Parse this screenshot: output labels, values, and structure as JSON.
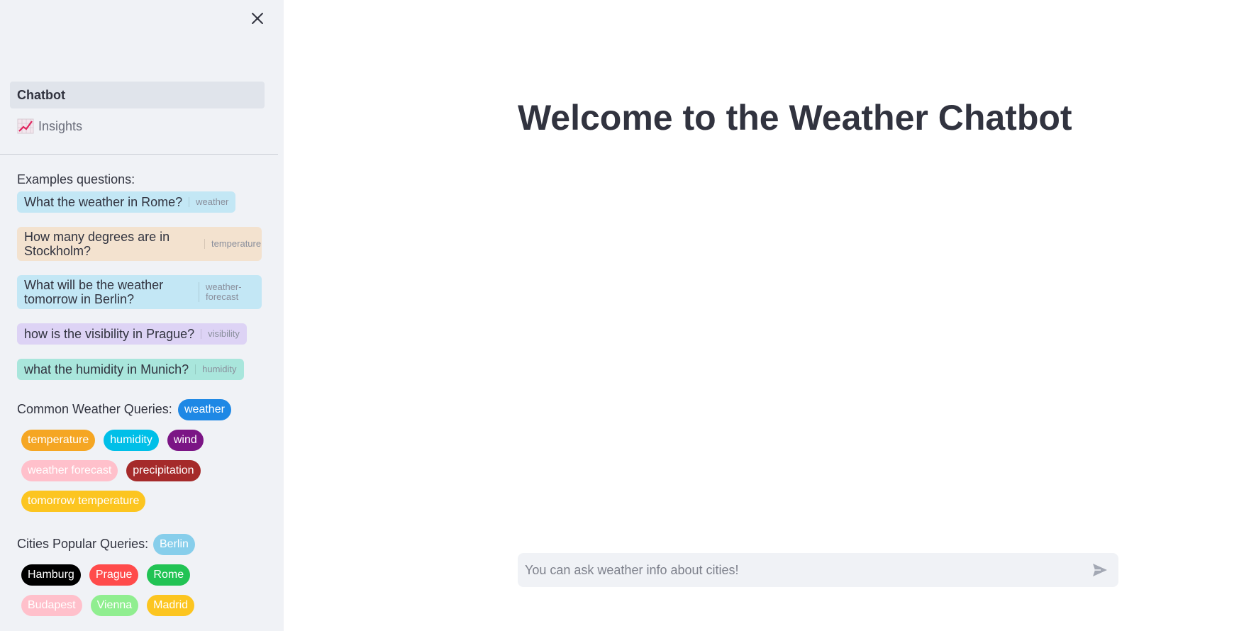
{
  "sidebar": {
    "nav": [
      {
        "label": "Chatbot",
        "active": true
      },
      {
        "label": "Insights",
        "icon": "chart-increasing-icon",
        "active": false
      }
    ],
    "examples_label": "Examples questions:",
    "examples": [
      {
        "text": "What the weather in Rome?",
        "tag": "weather",
        "color": "#c3e7f5"
      },
      {
        "text": "How many degrees are in Stockholm?",
        "tag": "temperature",
        "color": "#f3e2cf"
      },
      {
        "text": "What will be the weather tomorrow in Berlin?",
        "tag": "weather-forecast",
        "color": "#c3e7f5"
      },
      {
        "text": "how is the visibility in Prague?",
        "tag": "visibility",
        "color": "#ddd3f5"
      },
      {
        "text": "what the humidity in Munich?",
        "tag": "humidity",
        "color": "#a9e6dc"
      }
    ],
    "weather_label": "Common Weather Queries:",
    "weather_tags": [
      {
        "label": "weather",
        "color": "#1e88e5"
      },
      {
        "label": "temperature",
        "color": "#f5a623"
      },
      {
        "label": "humidity",
        "color": "#00bfe8"
      },
      {
        "label": "wind",
        "color": "#7b1585"
      },
      {
        "label": "weather forecast",
        "color": "#ffc0cb"
      },
      {
        "label": "precipitation",
        "color": "#a52a2a"
      },
      {
        "label": "tomorrow temperature",
        "color": "#fcc520"
      }
    ],
    "cities_label": "Cities Popular Queries:",
    "city_tags": [
      {
        "label": "Berlin",
        "color": "#87ceeb"
      },
      {
        "label": "Hamburg",
        "color": "#000000"
      },
      {
        "label": "Prague",
        "color": "#ff4b4b"
      },
      {
        "label": "Rome",
        "color": "#21c354"
      },
      {
        "label": "Budapest",
        "color": "#ffc0cb"
      },
      {
        "label": "Vienna",
        "color": "#90ee90"
      },
      {
        "label": "Madrid",
        "color": "#fcc520"
      }
    ]
  },
  "main": {
    "title": "Welcome to the Weather Chatbot",
    "chat_placeholder": "You can ask weather info about cities!"
  }
}
